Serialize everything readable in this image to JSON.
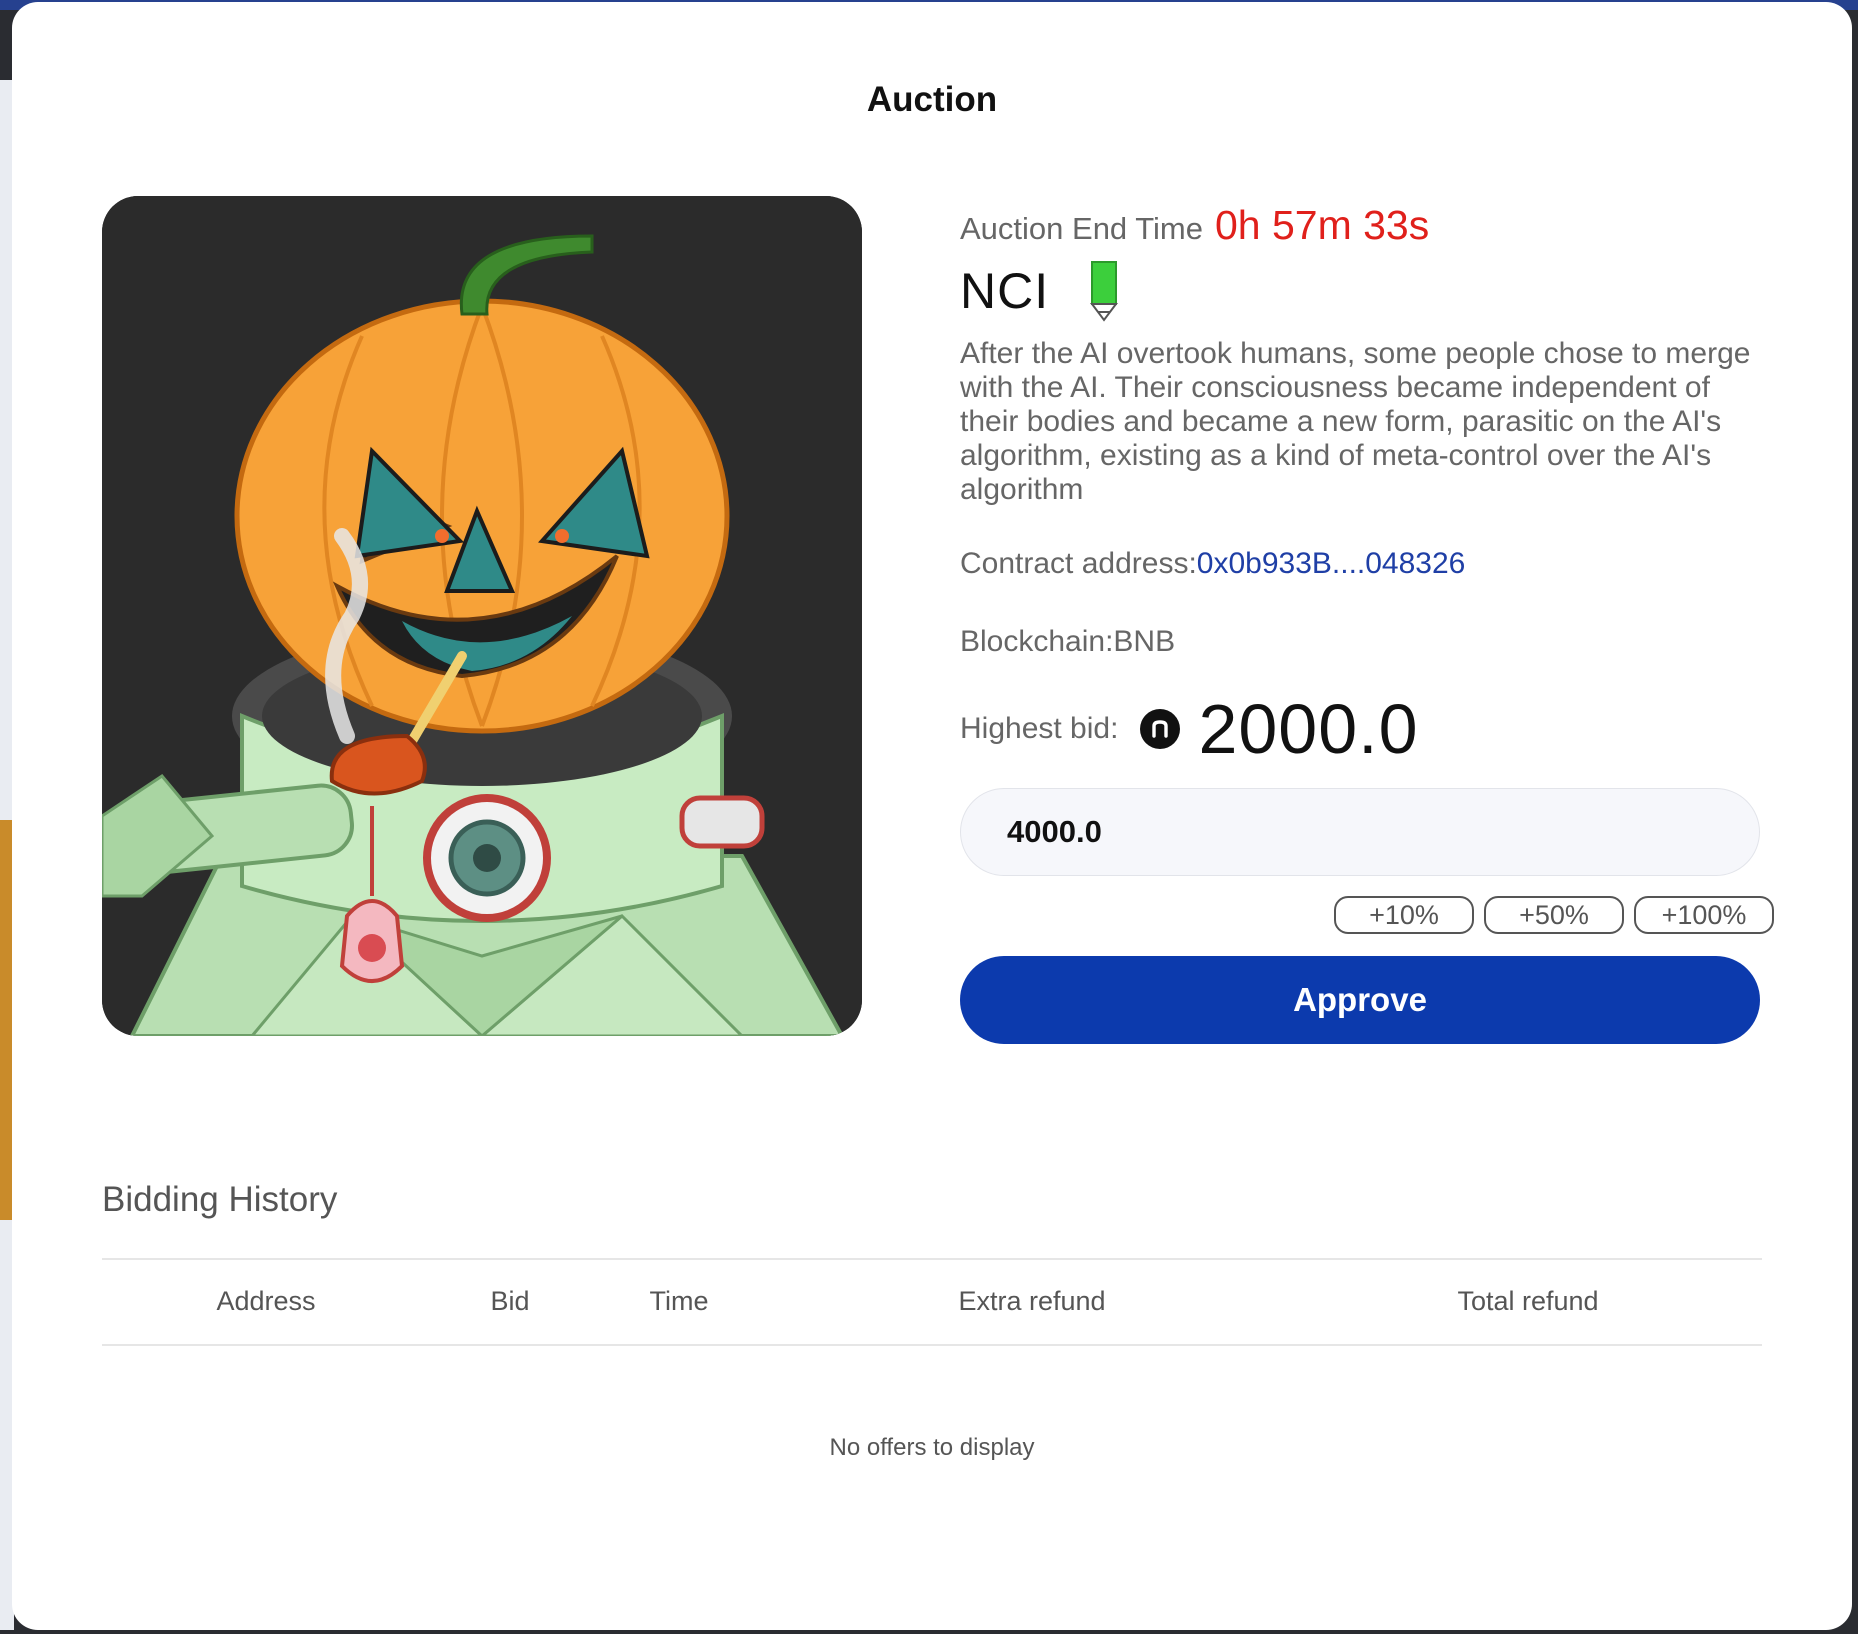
{
  "modal": {
    "title": "Auction"
  },
  "auction": {
    "end_time_label": "Auction End Time",
    "end_time_value": "0h 57m 33s",
    "name": "NCI",
    "description": "After the AI overtook humans, some people chose to merge with the AI. Their consciousness became independent of their bodies and became a new form, parasitic on the AI's algorithm, existing as a kind of meta-control over the AI's algorithm",
    "contract_label": "Contract address:",
    "contract_value": "0x0b933B....048326",
    "blockchain_label": "Blockchain:",
    "blockchain_value": "BNB",
    "highest_bid_label": "Highest bid:",
    "highest_bid_value": "2000.0"
  },
  "bid_form": {
    "input_value": "4000.0",
    "increments": [
      "+10%",
      "+50%",
      "+100%"
    ],
    "approve_label": "Approve"
  },
  "history": {
    "title": "Bidding History",
    "columns": [
      "Address",
      "Bid",
      "Time",
      "Extra refund",
      "Total refund"
    ],
    "empty_message": "No offers to display"
  },
  "colors": {
    "accent": "#0c3aad",
    "timer": "#e0201b",
    "link": "#1f3fa6",
    "badge": "#3ccf3c"
  },
  "icons": {
    "badge": "green-pencil-badge-icon",
    "currency": "n-coin-icon"
  }
}
